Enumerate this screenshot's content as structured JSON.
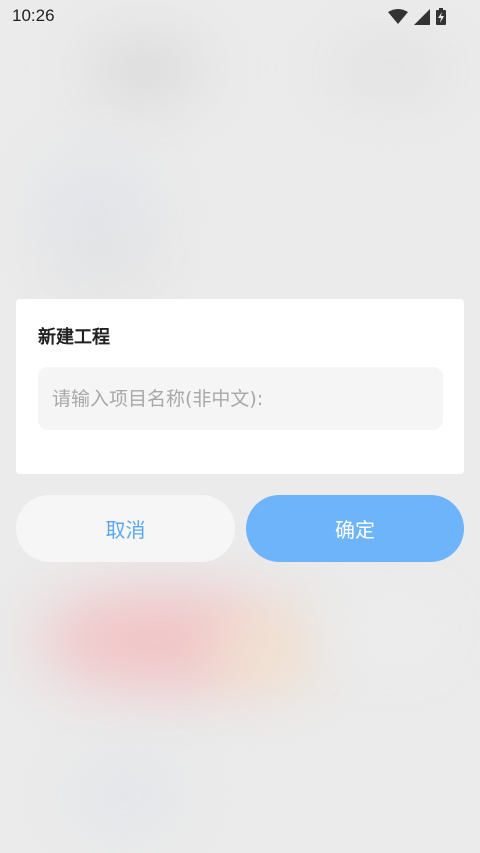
{
  "status_bar": {
    "time": "10:26",
    "icons": [
      "wifi-icon",
      "signal-icon",
      "battery-charging-icon"
    ]
  },
  "dialog": {
    "title": "新建工程",
    "input": {
      "value": "",
      "placeholder": "请输入项目名称(非中文):"
    }
  },
  "buttons": {
    "cancel_label": "取消",
    "confirm_label": "确定"
  },
  "colors": {
    "accent": "#6db4fb",
    "cancel_text": "#5aa7f0",
    "dialog_bg": "#ffffff",
    "overlay_bg": "#ebebeb"
  }
}
